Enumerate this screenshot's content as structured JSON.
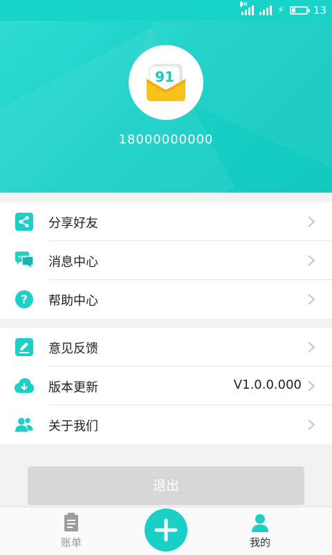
{
  "status_bar": {
    "network_label": "4G",
    "battery_level": "13"
  },
  "profile": {
    "phone_number": "18000000000",
    "app_logo_text": "91"
  },
  "menu_group_1": [
    {
      "label": "分享好友",
      "icon": "share-icon"
    },
    {
      "label": "消息中心",
      "icon": "message-icon"
    },
    {
      "label": "帮助中心",
      "icon": "help-icon"
    }
  ],
  "menu_group_2": [
    {
      "label": "意见反馈",
      "icon": "feedback-icon",
      "value": ""
    },
    {
      "label": "版本更新",
      "icon": "cloud-download-icon",
      "value": "V1.0.0.000"
    },
    {
      "label": "关于我们",
      "icon": "users-icon",
      "value": ""
    }
  ],
  "logout_label": "退出",
  "tab_bar": {
    "bill_label": "账单",
    "add_icon": "plus-icon",
    "mine_label": "我的",
    "active_tab": "mine"
  },
  "colors": {
    "accent": "#18d3c9",
    "icon": "#1ecfc6",
    "tab_inactive": "#999999",
    "logout_bg": "#d7d7d7"
  }
}
